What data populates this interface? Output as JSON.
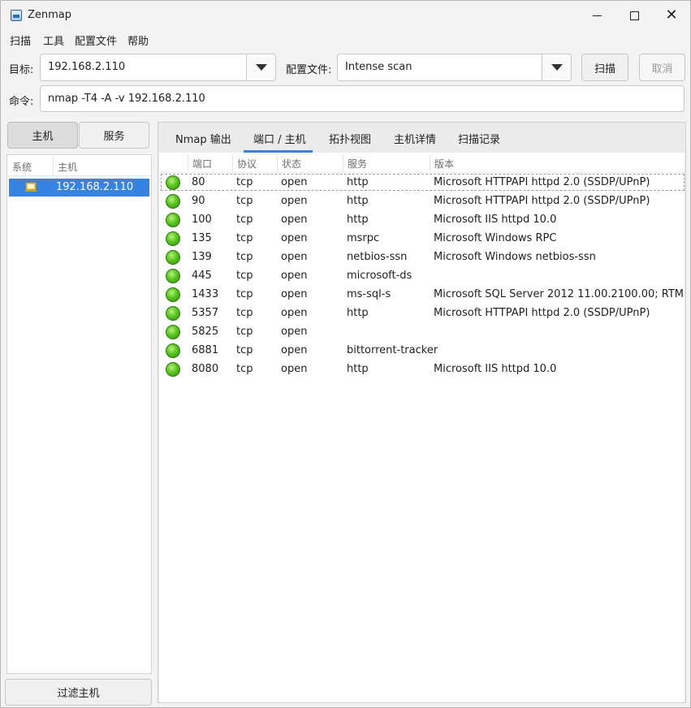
{
  "window": {
    "title": "Zenmap"
  },
  "menu": {
    "items": [
      "扫描",
      "工具",
      "配置文件",
      "帮助"
    ]
  },
  "target": {
    "label": "目标:",
    "value": "192.168.2.110"
  },
  "profile": {
    "label": "配置文件:",
    "value": "Intense scan"
  },
  "buttons": {
    "scan": "扫描",
    "cancel": "取消",
    "filter_hosts": "过滤主机"
  },
  "command": {
    "label": "命令:",
    "value": "nmap -T4 -A -v 192.168.2.110"
  },
  "left_panel": {
    "toggle_hosts": "主机",
    "toggle_services": "服务",
    "columns": [
      "系统",
      "主机"
    ],
    "hosts": [
      {
        "ip": "192.168.2.110",
        "os_icon": "windows-os-icon"
      }
    ]
  },
  "tabs": [
    "Nmap 输出",
    "端口 / 主机",
    "拓扑视图",
    "主机详情",
    "扫描记录"
  ],
  "active_tab": "端口 / 主机",
  "ports_table": {
    "columns": [
      "端口",
      "协议",
      "状态",
      "服务",
      "版本"
    ],
    "rows": [
      {
        "port": "80",
        "proto": "tcp",
        "state": "open",
        "service": "http",
        "version": "Microsoft HTTPAPI httpd 2.0 (SSDP/UPnP)"
      },
      {
        "port": "90",
        "proto": "tcp",
        "state": "open",
        "service": "http",
        "version": "Microsoft HTTPAPI httpd 2.0 (SSDP/UPnP)"
      },
      {
        "port": "100",
        "proto": "tcp",
        "state": "open",
        "service": "http",
        "version": "Microsoft IIS httpd 10.0"
      },
      {
        "port": "135",
        "proto": "tcp",
        "state": "open",
        "service": "msrpc",
        "version": "Microsoft Windows RPC"
      },
      {
        "port": "139",
        "proto": "tcp",
        "state": "open",
        "service": "netbios-ssn",
        "version": "Microsoft Windows netbios-ssn"
      },
      {
        "port": "445",
        "proto": "tcp",
        "state": "open",
        "service": "microsoft-ds",
        "version": ""
      },
      {
        "port": "1433",
        "proto": "tcp",
        "state": "open",
        "service": "ms-sql-s",
        "version": "Microsoft SQL Server 2012 11.00.2100.00; RTM"
      },
      {
        "port": "5357",
        "proto": "tcp",
        "state": "open",
        "service": "http",
        "version": "Microsoft HTTPAPI httpd 2.0 (SSDP/UPnP)"
      },
      {
        "port": "5825",
        "proto": "tcp",
        "state": "open",
        "service": "",
        "version": ""
      },
      {
        "port": "6881",
        "proto": "tcp",
        "state": "open",
        "service": "bittorrent-tracker",
        "version": ""
      },
      {
        "port": "8080",
        "proto": "tcp",
        "state": "open",
        "service": "http",
        "version": "Microsoft IIS httpd 10.0"
      }
    ],
    "status_icon": "open-status-green-icon"
  },
  "colors": {
    "accent": "#3584e4",
    "open": "#5ac61f"
  }
}
